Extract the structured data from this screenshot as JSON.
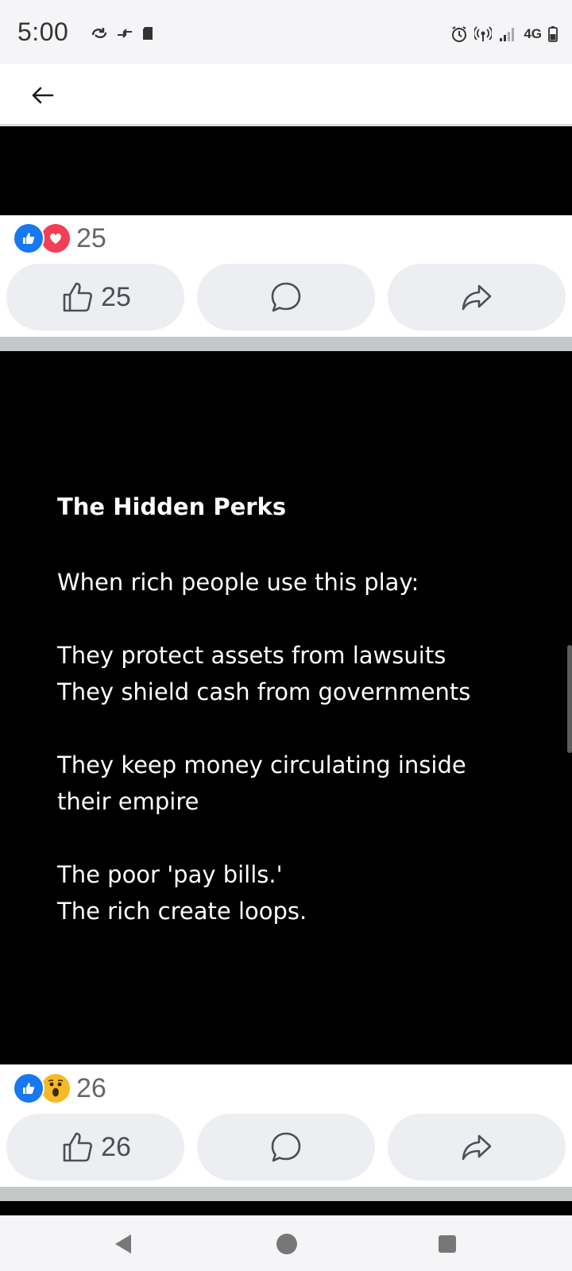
{
  "status_bar": {
    "time": "5:00",
    "left_icons": [
      "sync-icon",
      "data-transfer-icon",
      "sd-card-icon"
    ],
    "right_icons": [
      "alarm-icon",
      "hotspot-icon",
      "signal-icon",
      "battery-icon"
    ],
    "network": "4G"
  },
  "top_nav": {
    "back_icon": "back-arrow-icon"
  },
  "post1": {
    "reactions": [
      "like",
      "love"
    ],
    "reaction_count": "25",
    "like_count": "25"
  },
  "post2": {
    "title": "The Hidden Perks",
    "lines": [
      "When rich people use this play:",
      "They protect assets from lawsuits",
      "They shield cash from governments",
      "They keep money circulating inside",
      "their empire",
      "The poor 'pay bills.'",
      "The rich create loops."
    ],
    "reactions": [
      "like",
      "wow"
    ],
    "reaction_count": "26",
    "like_count": "26"
  },
  "colors": {
    "like_blue": "#1877f2",
    "love_red": "#f33e58",
    "wow_yellow": "#f7b928",
    "post_background": "#000000",
    "button_background": "#eceef1"
  },
  "nav_bar": {
    "buttons": [
      "nav-back-icon",
      "nav-home-icon",
      "nav-recents-icon"
    ]
  }
}
